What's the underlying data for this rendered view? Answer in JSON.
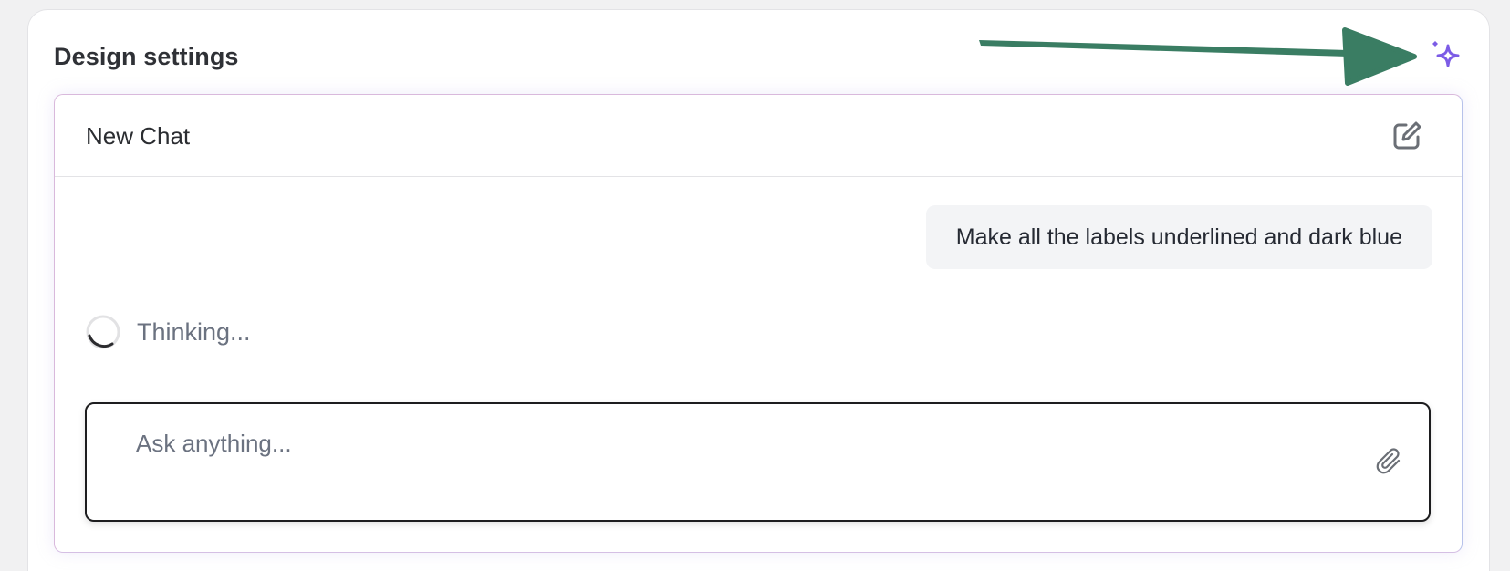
{
  "panel": {
    "title": "Design settings",
    "ai_button_icon": "sparkles-icon"
  },
  "chat": {
    "title": "New Chat",
    "new_chat_icon": "edit-square-icon",
    "messages": [
      {
        "role": "user",
        "text": "Make all the labels underlined and dark blue"
      }
    ],
    "status": {
      "icon": "spinner-icon",
      "text": "Thinking..."
    },
    "input": {
      "value": "",
      "placeholder": "Ask anything...",
      "attach_icon": "paperclip-icon"
    }
  },
  "annotation": {
    "arrow_color": "#3a7d63",
    "target": "ai-sparkle-button"
  },
  "colors": {
    "accent": "#7c5ce6",
    "background": "#f1f1f2",
    "bubble": "#f3f4f6"
  }
}
